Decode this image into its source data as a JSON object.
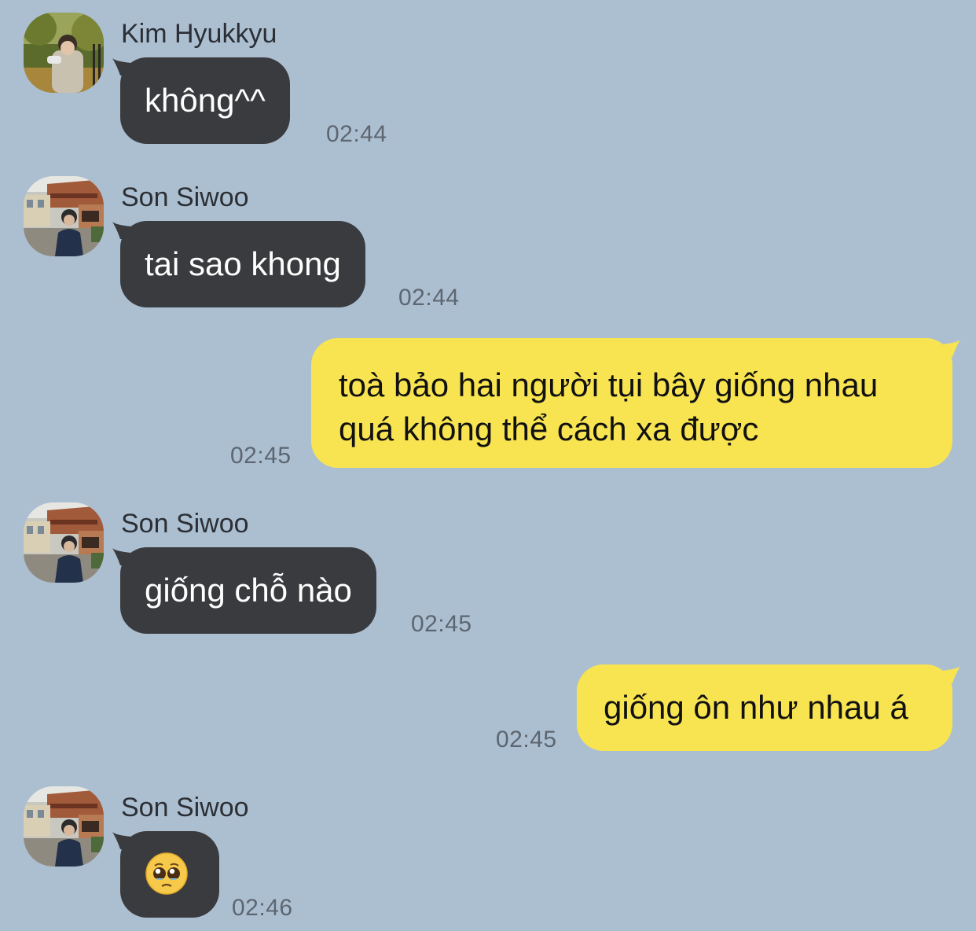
{
  "messages": [
    {
      "sender": "Kim Hyukkyu",
      "text": "không^^",
      "time": "02:44",
      "avatar": "avatar-outdoor-trees"
    },
    {
      "sender": "Son Siwoo",
      "text": "tai sao khong",
      "time": "02:44",
      "avatar": "avatar-street-buildings"
    },
    {
      "line1": "toà bảo hai người tụi bây giống nhau",
      "line2": "quá không thể cách xa được",
      "time": "02:45"
    },
    {
      "sender": "Son Siwoo",
      "text": "giống chỗ nào",
      "time": "02:45",
      "avatar": "avatar-street-buildings"
    },
    {
      "text": "giống ôn như nhau á",
      "time": "02:45"
    },
    {
      "sender": "Son Siwoo",
      "emoji": "pleading-face-emoji",
      "time": "02:46",
      "avatar": "avatar-street-buildings"
    }
  ],
  "colors": {
    "background": "#acbfd1",
    "incoming_bubble": "#3a3b3e",
    "outgoing_bubble": "#f8e451",
    "timestamp": "#5d6670"
  }
}
